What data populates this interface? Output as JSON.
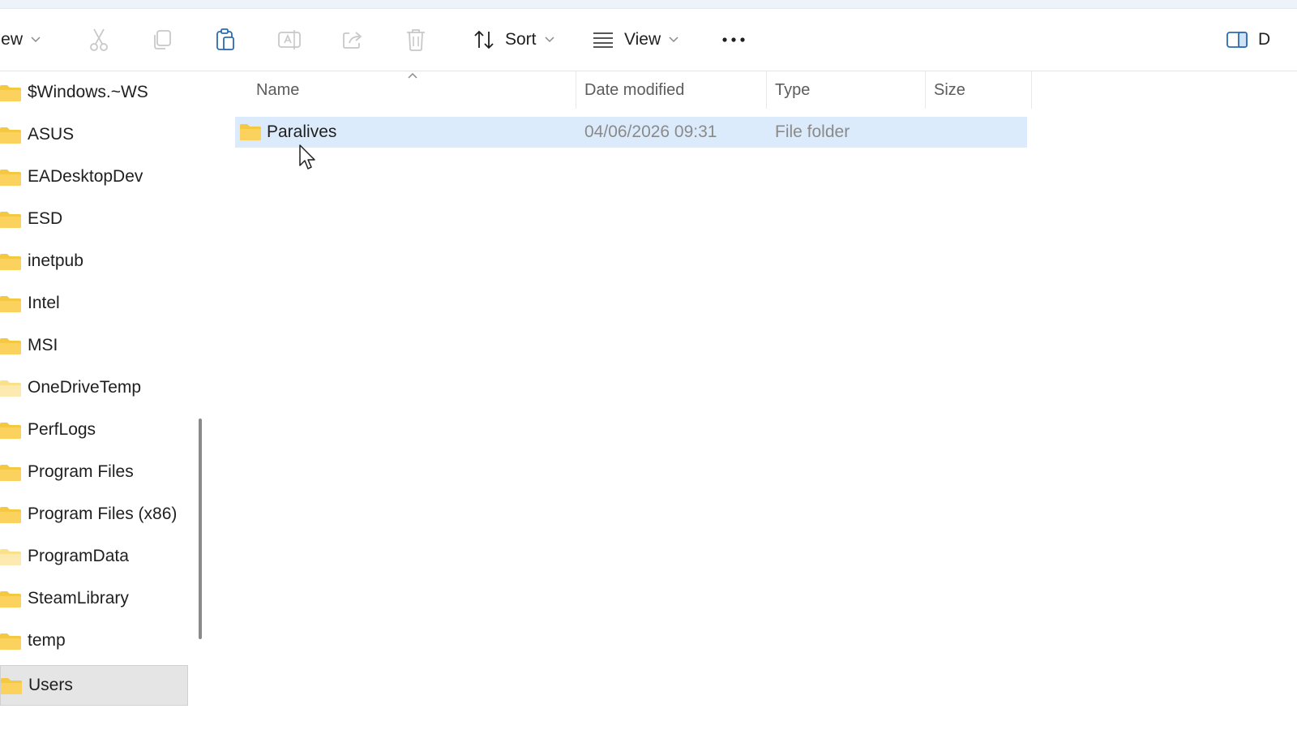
{
  "toolbar": {
    "new_label": "New",
    "sort_label": "Sort",
    "view_label": "View",
    "details_label": "D",
    "icons": [
      "cut-icon",
      "copy-icon",
      "paste-icon",
      "rename-icon",
      "share-icon",
      "delete-icon",
      "sort-icon",
      "view-icon",
      "more-icon",
      "details-pane-icon"
    ]
  },
  "sidebar": {
    "items": [
      {
        "label": "$Windows.~WS"
      },
      {
        "label": "ASUS"
      },
      {
        "label": "EADesktopDev"
      },
      {
        "label": "ESD"
      },
      {
        "label": "inetpub"
      },
      {
        "label": "Intel"
      },
      {
        "label": "MSI"
      },
      {
        "label": "OneDriveTemp"
      },
      {
        "label": "PerfLogs"
      },
      {
        "label": "Program Files"
      },
      {
        "label": "Program Files (x86)"
      },
      {
        "label": "ProgramData"
      },
      {
        "label": "SteamLibrary"
      },
      {
        "label": "temp"
      },
      {
        "label": "Users"
      }
    ],
    "selected": "Users"
  },
  "columns": {
    "name": "Name",
    "date_modified": "Date modified",
    "type": "Type",
    "size": "Size"
  },
  "files": [
    {
      "name": "Paralives",
      "date_modified": "04/06/2026 09:31",
      "type": "File folder",
      "size": ""
    }
  ],
  "colors": {
    "folder": "#f5c842",
    "folder_light": "#fbe08a",
    "row_selected": "#dcebfb",
    "sidebar_selected": "#e5e5e5"
  }
}
